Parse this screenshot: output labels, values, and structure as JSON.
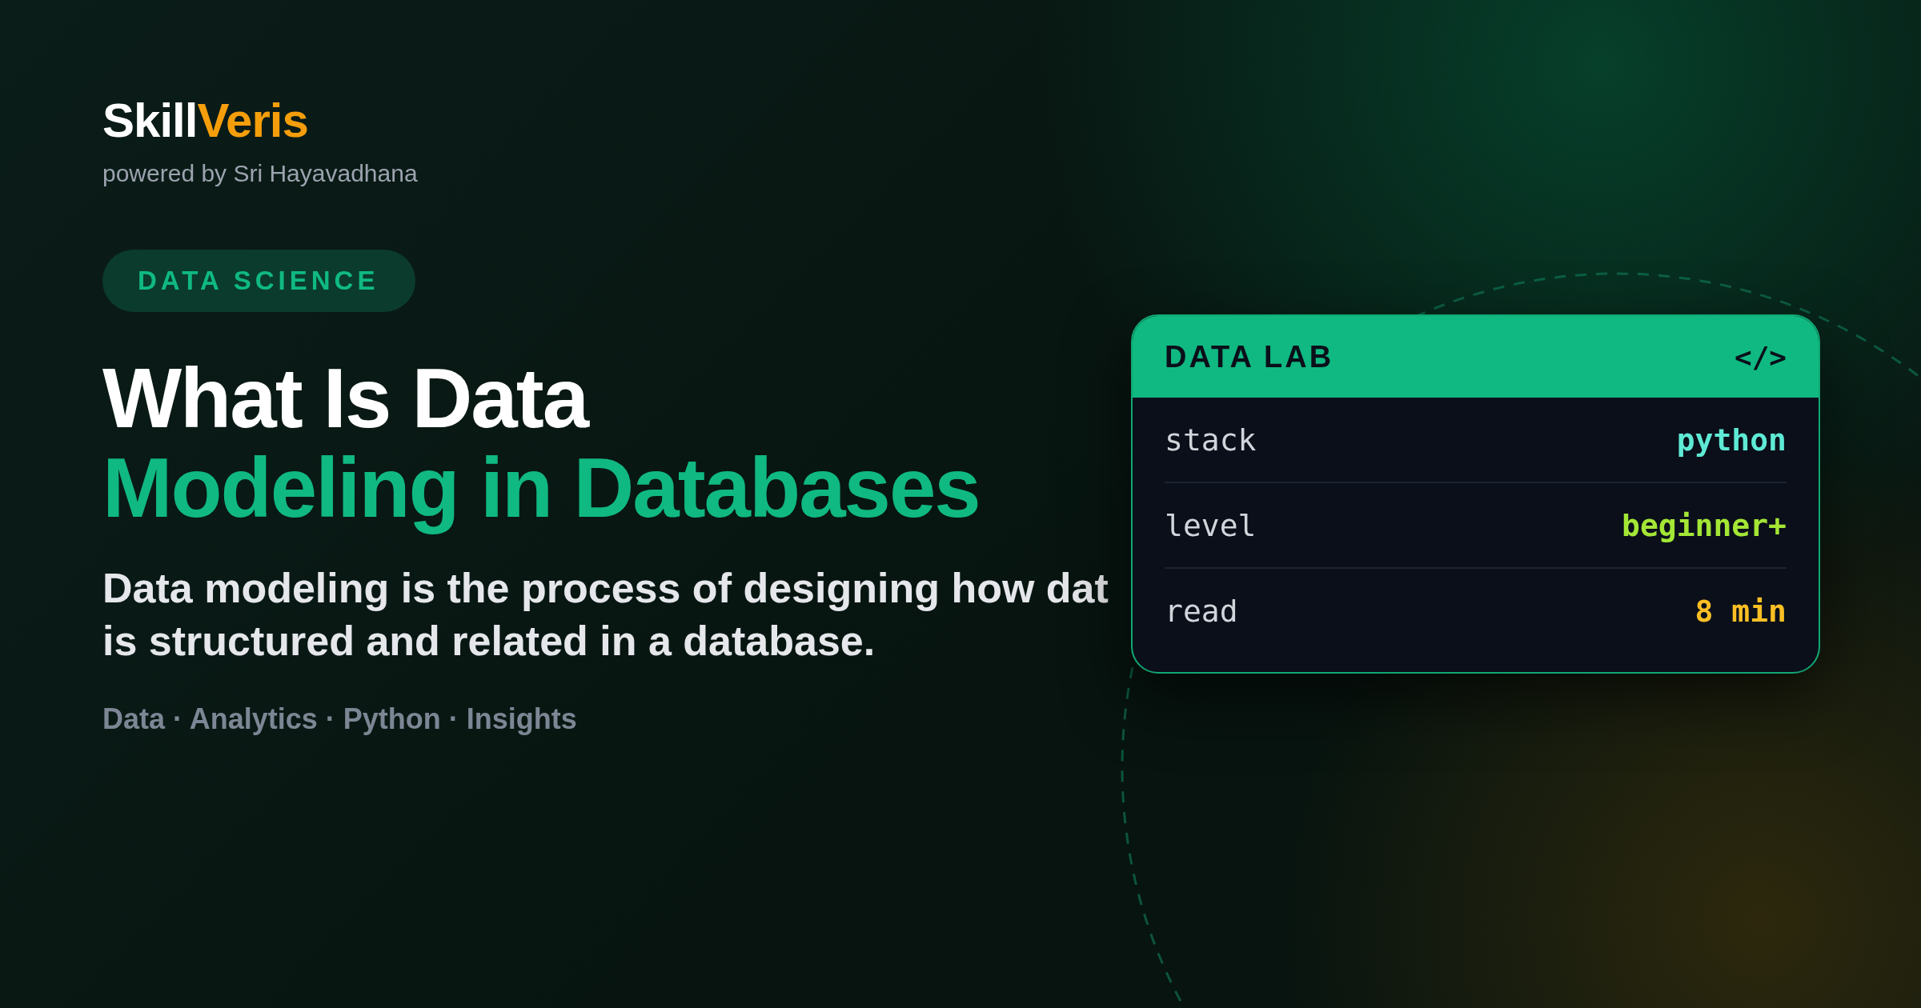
{
  "brand": {
    "first": "Skill",
    "second": "Veris",
    "tagline": "powered by Sri Hayavadhana"
  },
  "category": "DATA SCIENCE",
  "title": {
    "line1": "What Is Data",
    "line2": "Modeling in Databases"
  },
  "description": [
    "Data modeling is the process of designing how dat",
    "is structured and related in a database."
  ],
  "tags": "Data · Analytics · Python · Insights",
  "card": {
    "title": "DATA LAB",
    "glyph": "</>",
    "rows": [
      {
        "key": "stack",
        "value": "python",
        "color": "#5eead4"
      },
      {
        "key": "level",
        "value": "beginner+",
        "color": "#a3e635"
      },
      {
        "key": "read",
        "value": "8 min",
        "color": "#fbbf24"
      }
    ]
  }
}
